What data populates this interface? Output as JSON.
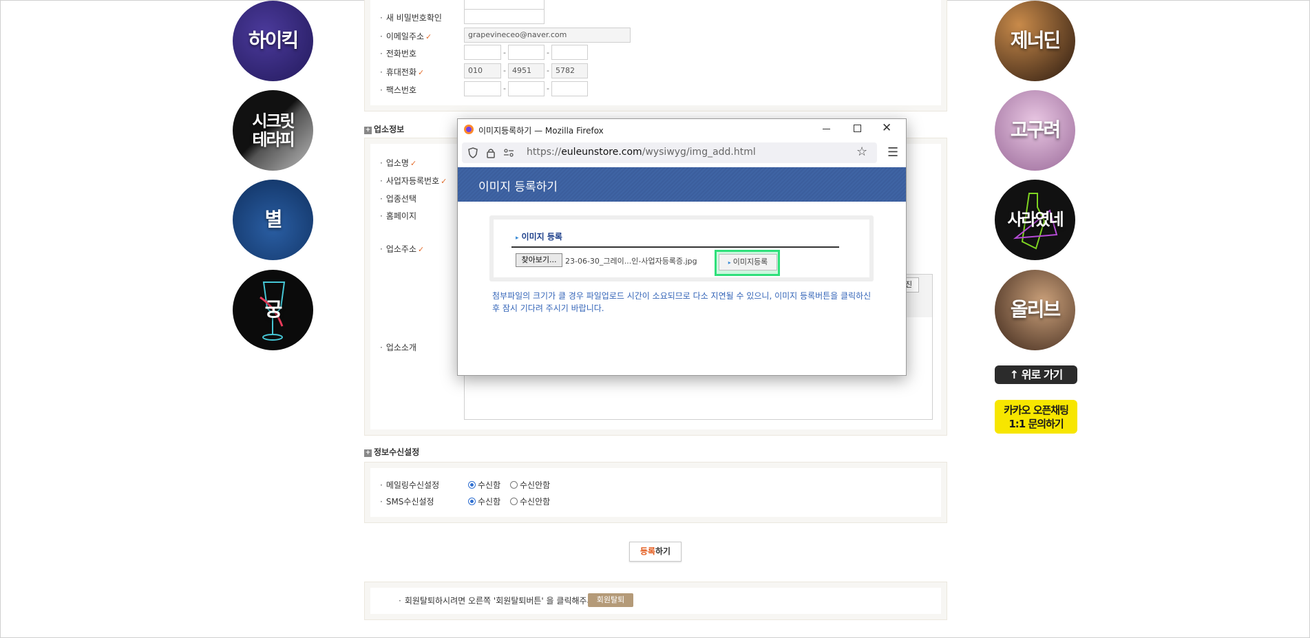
{
  "left_circles": [
    {
      "label": "하이킥",
      "bg": "#3a2a7a"
    },
    {
      "label": "시크릿 테라피",
      "bg": "#2a2a2a"
    },
    {
      "label": "별",
      "bg": "#153f77"
    },
    {
      "label": "궁",
      "bg": "#0d0d0d"
    }
  ],
  "right_circles": [
    {
      "label": "제너딘",
      "bg": "#5b3a24"
    },
    {
      "label": "고구려",
      "bg": "#b98ab5"
    },
    {
      "label": "사라였네",
      "bg": "#111111"
    },
    {
      "label": "올리브",
      "bg": "#4a3224"
    }
  ],
  "side_buttons": {
    "top_label": "↑ 위로 가기",
    "kakao_line1": "카카오 오픈채팅",
    "kakao_line2": "1:1 문의하기"
  },
  "account": {
    "new_pw_label": "새 비밀번호확인",
    "email_label": "이메일주소",
    "email_value": "grapevineceo@naver.com",
    "phone_label": "전화번호",
    "mobile_label": "휴대전화",
    "mobile": [
      "010",
      "4951",
      "5782"
    ],
    "fax_label": "팩스번호",
    "check": "✓"
  },
  "business": {
    "section_title": "업소정보",
    "name_label": "업소명",
    "reg_no_label": "사업자등록번호",
    "category_label": "업종선택",
    "homepage_label": "홈페이지",
    "address_label": "업소주소",
    "intro_label": "업소소개",
    "partial_btn": "진"
  },
  "subscription": {
    "section_title": "정보수신설정",
    "mail_label": "메일링수신설정",
    "sms_label": "SMS수신설정",
    "yes": "수신함",
    "no": "수신안함"
  },
  "submit": {
    "accent": "등록",
    "rest": "하기"
  },
  "withdraw": {
    "text": "회원탈퇴하시려면 오른쪽 '회원탈퇴버튼' 을 클릭해주세요.",
    "button": "회원탈퇴"
  },
  "popup": {
    "window_title": "이미지등록하기 — Mozilla Firefox",
    "url_prefix": "https://",
    "url_domain": "euleunstore.com",
    "url_path": "/wysiwyg/img_add.html",
    "header": "이미지 등록하기",
    "section_label": "이미지 등록",
    "browse_button": "찾아보기...",
    "file_name": "23-06-30_그레이...인-사업자등록증.jpg",
    "register_button": "이미지등록",
    "notice": "첨부파일의 크기가 클 경우 파일업로드 시간이 소요되므로 다소 지연될 수 있으니, 이미지 등록버튼을 클릭하신 후 잠시 기다려 주시기 바랍니다."
  }
}
